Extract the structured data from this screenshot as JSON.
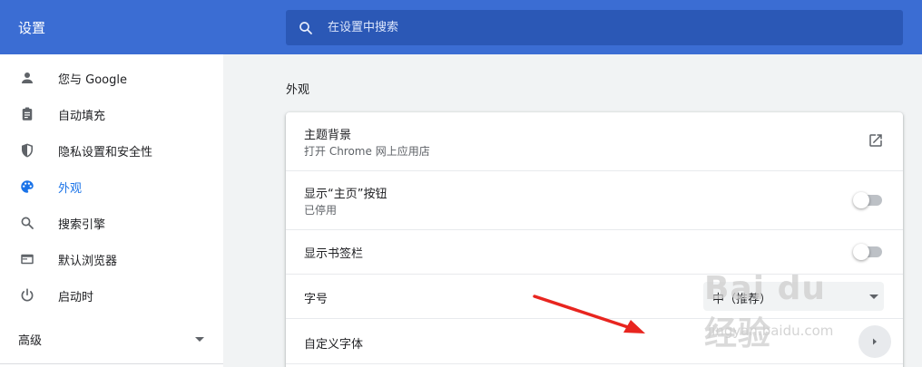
{
  "header": {
    "title": "设置",
    "search_placeholder": "在设置中搜索"
  },
  "sidebar": {
    "items": [
      {
        "label": "您与 Google",
        "icon": "person-icon",
        "active": false
      },
      {
        "label": "自动填充",
        "icon": "clipboard-icon",
        "active": false
      },
      {
        "label": "隐私设置和安全性",
        "icon": "shield-icon",
        "active": false
      },
      {
        "label": "外观",
        "icon": "palette-icon",
        "active": true
      },
      {
        "label": "搜索引擎",
        "icon": "search-icon",
        "active": false
      },
      {
        "label": "默认浏览器",
        "icon": "browser-window-icon",
        "active": false
      },
      {
        "label": "启动时",
        "icon": "power-icon",
        "active": false
      }
    ],
    "advanced_label": "高级"
  },
  "main": {
    "section_title": "外观",
    "rows": [
      {
        "title": "主题背景",
        "subtitle": "打开 Chrome 网上应用店",
        "control": "open-in-new-icon"
      },
      {
        "title": "显示“主页”按钮",
        "subtitle": "已停用",
        "control": "toggle",
        "checked": false
      },
      {
        "title": "显示书签栏",
        "control": "toggle",
        "checked": false
      },
      {
        "title": "字号",
        "control": "select",
        "value": "中（推荐）"
      },
      {
        "title": "自定义字体",
        "control": "chevron-right-icon"
      }
    ]
  },
  "watermark": {
    "brand": "Bai du 经验",
    "url": "jingyan.baidu.com"
  },
  "colors": {
    "header_bg": "#3b6dd3",
    "search_bg": "#2b58b6",
    "accent": "#1a73e8",
    "annotation_arrow": "#e8251f"
  }
}
